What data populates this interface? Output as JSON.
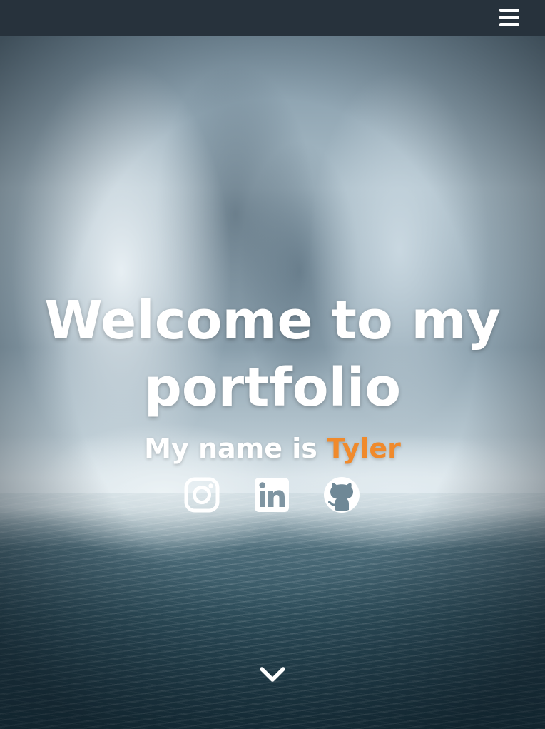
{
  "navbar": {
    "menu_icon": "hamburger-menu-icon"
  },
  "hero": {
    "title": "Welcome to my portfolio",
    "subtitle_prefix": "My name is ",
    "subtitle_name": "Tyler",
    "background": "waterfall-photo"
  },
  "socials": [
    {
      "icon": "instagram-icon"
    },
    {
      "icon": "linkedin-icon"
    },
    {
      "icon": "github-icon"
    }
  ],
  "scroll": {
    "icon": "chevron-down-icon"
  },
  "colors": {
    "navbar": "#27323c",
    "text": "#ffffff",
    "accent": "#f08a2c"
  }
}
